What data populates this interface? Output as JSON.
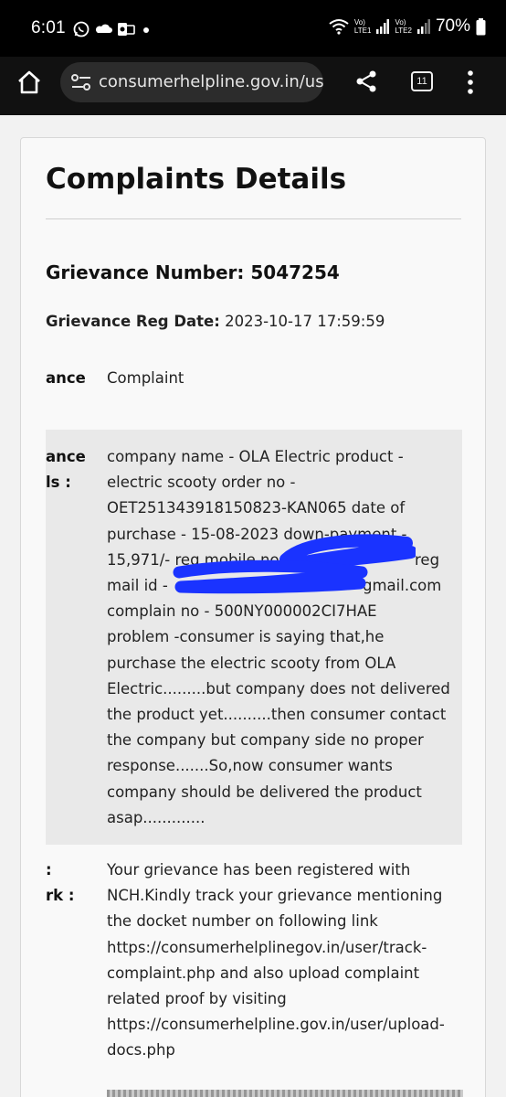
{
  "status_bar": {
    "time": "6:01",
    "battery": "70%",
    "lte1": [
      "Vo)",
      "LTE1"
    ],
    "lte2": [
      "Vo)",
      "LTE2"
    ]
  },
  "browser": {
    "url": "consumerhelpline.gov.in/us",
    "tab_count": "11"
  },
  "page": {
    "title": "Complaints Details",
    "grievance_number": "Grievance Number: 5047254",
    "reg_date_label": "Grievance Reg Date:",
    "reg_date_value": "2023-10-17 17:59:59",
    "rows": [
      {
        "label": "ance",
        "value": "Complaint"
      },
      {
        "label_lines": [
          "ance",
          "ls :"
        ],
        "value_lines": [
          "company name - OLA Electric product -",
          "electric scooty order no -",
          "OET251343918150823-KAN065 date of",
          "purchase - 15-08-2023 down-payment -",
          "15,971/- reg mobile no",
          "mail id -",
          "complain no - 500NY000002CI7HAE",
          "problem -consumer is saying that,he",
          "purchase the electric scooty from OLA",
          "Electric.........but company does not delivered",
          "the product yet..........then consumer contact",
          "the company but company side no proper",
          "response.......So,now consumer wants",
          "company should be delivered the product",
          "asap............."
        ],
        "fragments": {
          "reg": "reg",
          "gmail": "gmail.com"
        }
      },
      {
        "label_lines": [
          ":",
          "rk :"
        ],
        "value_lines": [
          "Your grievance has been registered with",
          "NCH.Kindly track your grievance mentioning",
          "the docket number on following link",
          "https://consumerhelplinegov.in/user/track-",
          "complaint.php and also upload complaint",
          "related proof by visiting",
          "https://consumerhelpline.gov.in/user/upload-",
          "docs.php"
        ]
      }
    ]
  },
  "colors": {
    "scribble": "#1a33ff",
    "page_bg": "#f2f2f2",
    "card_bg": "#f9f9f9",
    "highlight_bg": "#e9e9e9"
  }
}
